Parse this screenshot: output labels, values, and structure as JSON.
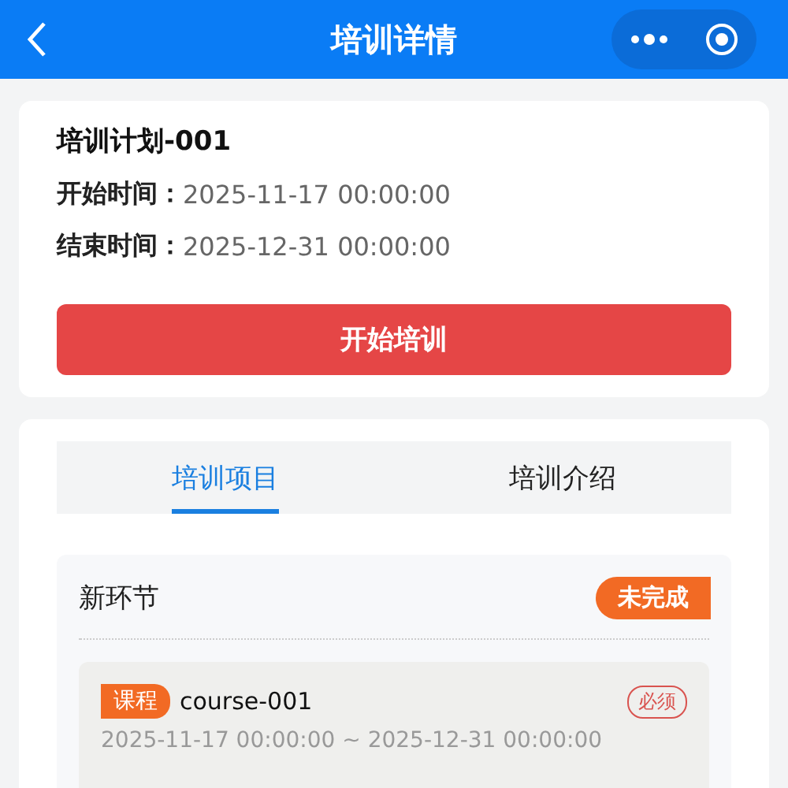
{
  "nav": {
    "title": "培训详情"
  },
  "plan": {
    "title": "培训计划-001",
    "fields": [
      {
        "label": "开始时间：",
        "value": "2025-11-17 00:00:00"
      },
      {
        "label": "结束时间：",
        "value": "2025-12-31 00:00:00"
      }
    ],
    "button": "开始培训"
  },
  "tabs": [
    {
      "label": "培训项目",
      "selected": true
    },
    {
      "label": "培训介绍",
      "selected": false
    }
  ],
  "sections": [
    {
      "title": "新环节",
      "status": "未完成",
      "items": [
        {
          "tag": "课程",
          "name": "course-001",
          "required": "必须",
          "period": "2025-11-17 00:00:00 ~ 2025-12-31 00:00:00"
        }
      ]
    }
  ]
}
